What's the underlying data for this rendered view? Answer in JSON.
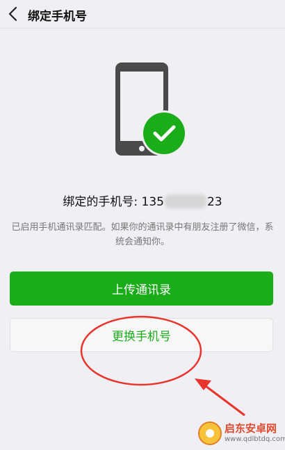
{
  "header": {
    "title": "绑定手机号",
    "back_icon": "chevron-left-icon"
  },
  "illustration": {
    "phone_icon": "smartphone-icon",
    "check_icon": "check-circle-icon",
    "check_color": "#1aad19"
  },
  "bound": {
    "label": "绑定的手机号: ",
    "number_prefix": "135",
    "number_suffix": "23"
  },
  "description": "已启用手机通讯录匹配。如果你的通讯录中有朋友注册了微信，系统会通知你。",
  "buttons": {
    "upload_label": "上传通讯录",
    "change_label": "更换手机号"
  },
  "colors": {
    "accent": "#1aad19",
    "background": "#efeff4",
    "annotation": "#e8342c"
  },
  "watermark": {
    "name": "启东安卓网",
    "url": "www.qdlbtdq.com"
  }
}
